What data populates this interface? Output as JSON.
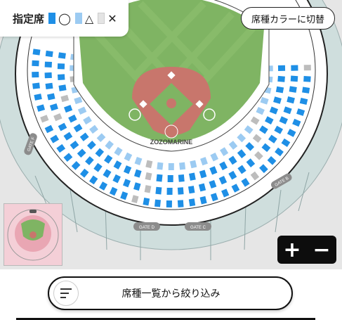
{
  "legend": {
    "title": "指定席",
    "symbols": [
      "◯",
      "△",
      "✕"
    ],
    "colors": [
      "#1e8fe6",
      "#9ccbf2",
      "#e4e4e4"
    ]
  },
  "toolbar": {
    "seat_color_toggle_label": "席種カラーに切替"
  },
  "stadium": {
    "name": "ZOZOMARINE",
    "gates": [
      "GATE F",
      "GATE D",
      "GATE C",
      "GATE B"
    ],
    "field_color": "#7fb463",
    "infield_color": "#c8766c",
    "seat_color": "#1e8fe6",
    "light_seat_color": "#9ccbf2",
    "gray_seat_color": "#bdbdbd"
  },
  "zoom": {
    "in_label": "+",
    "out_label": "−"
  },
  "filter": {
    "label": "席種一覧から絞り込み"
  }
}
